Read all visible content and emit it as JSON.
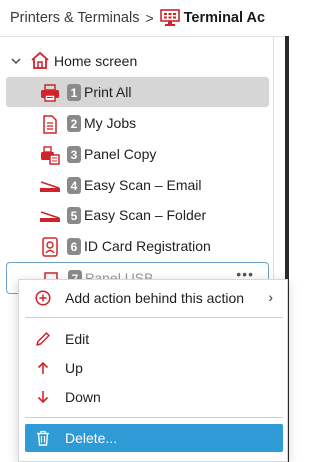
{
  "breadcrumb": {
    "parent": "Printers & Terminals",
    "separator": ">",
    "current": "Terminal Ac",
    "current_icon": "terminal-icon"
  },
  "tree": {
    "root": {
      "label": "Home screen",
      "icon": "home-icon",
      "expanded": true
    },
    "items": [
      {
        "number": "1",
        "label": "Print All",
        "icon": "print-all-icon",
        "selected": true
      },
      {
        "number": "2",
        "label": "My Jobs",
        "icon": "my-jobs-icon"
      },
      {
        "number": "3",
        "label": "Panel Copy",
        "icon": "panel-copy-icon"
      },
      {
        "number": "4",
        "label": "Easy Scan – Email",
        "icon": "scan-icon"
      },
      {
        "number": "5",
        "label": "Easy Scan – Folder",
        "icon": "scan-icon"
      },
      {
        "number": "6",
        "label": "ID Card Registration",
        "icon": "id-card-icon"
      },
      {
        "number": "7",
        "label": "Panel USB",
        "icon": "usb-icon",
        "more": "•••"
      }
    ]
  },
  "context_menu": {
    "items": [
      {
        "label": "Add action behind this action",
        "icon": "add-circle-icon",
        "submenu": "›"
      },
      {
        "label": "Edit",
        "icon": "pencil-icon"
      },
      {
        "label": "Up",
        "icon": "arrow-up-icon"
      },
      {
        "label": "Down",
        "icon": "arrow-down-icon"
      },
      {
        "label": "Delete...",
        "icon": "trash-icon",
        "highlighted": true
      }
    ]
  },
  "colors": {
    "accent_red": "#d2232a",
    "selection_gray": "#d6d6d6",
    "menu_highlight": "#2e9bd6",
    "badge_gray": "#8a8a8a"
  }
}
